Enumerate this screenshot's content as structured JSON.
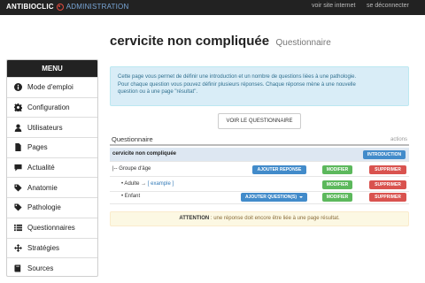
{
  "topbar": {
    "brand_a": "ANTIBIOCLIC",
    "brand_b": "ADMINISTRATION",
    "links": [
      "voir site internet",
      "se déconnecter"
    ]
  },
  "sidebar": {
    "header": "MENU",
    "items": [
      {
        "label": "Mode d'emploi",
        "icon": "info-icon"
      },
      {
        "label": "Configuration",
        "icon": "gear-icon"
      },
      {
        "label": "Utilisateurs",
        "icon": "user-icon"
      },
      {
        "label": "Pages",
        "icon": "file-icon"
      },
      {
        "label": "Actualité",
        "icon": "comment-icon"
      },
      {
        "label": "Anatomie",
        "icon": "tag-icon"
      },
      {
        "label": "Pathologie",
        "icon": "tag-icon"
      },
      {
        "label": "Questionnaires",
        "icon": "list-icon"
      },
      {
        "label": "Stratégies",
        "icon": "move-icon"
      },
      {
        "label": "Sources",
        "icon": "book-icon"
      }
    ]
  },
  "page": {
    "title": "cervicite non compliquée",
    "subtitle": "Questionnaire"
  },
  "info": {
    "lines": [
      "Cette page vous permet de définir une introduction et un nombre de questions liées à une pathologie.",
      "Pour chaque question vous pouvez définir plusieurs réponses. Chaque réponse mène à une nouvelle",
      "question ou à une page \"résultat\"."
    ]
  },
  "view_button": "VOIR LE QUESTIONNAIRE",
  "questionnaire": {
    "heading": "Questionnaire",
    "actions_label": "actions",
    "root": {
      "label": "cervicite non compliquée",
      "button": "INTRODUCTION"
    },
    "rows": [
      {
        "label": "|-- Groupe d'âge",
        "primary": "AJOUTER REPONSE",
        "edit": "MODIFIER",
        "delete": "SUPPRIMER"
      },
      {
        "label_prefix": "• Adulte →",
        "link": "[ example ]",
        "edit": "MODIFIER",
        "delete": "SUPPRIMER"
      },
      {
        "label": "• Enfant",
        "primary": "AJOUTER QUESTION(S)",
        "edit": "MODIFIER",
        "delete": "SUPPRIMER"
      }
    ]
  },
  "warning": {
    "strong": "ATTENTION",
    "text": " : une réponse doit encore être liée à une page résultat."
  },
  "colors": {
    "topbar": "#222222",
    "accent_red": "#e14b40",
    "primary": "#428bca",
    "success": "#5cb85c",
    "danger": "#d9534f",
    "info_bg": "#d9edf7",
    "warning_bg": "#fcf8e3"
  }
}
